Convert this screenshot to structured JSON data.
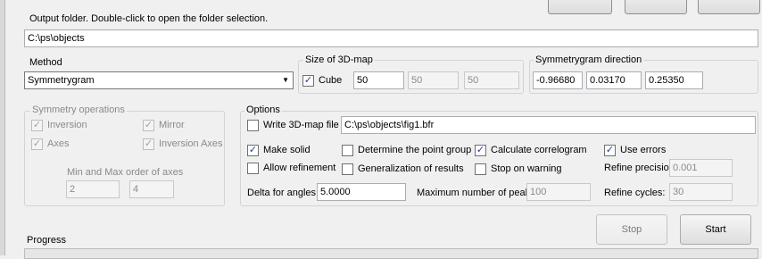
{
  "output_folder": {
    "hint": "Output folder. Double-click to open the folder selection.",
    "path": "C:\\ps\\objects"
  },
  "method": {
    "label": "Method",
    "selected": "Symmetrygram"
  },
  "map_size": {
    "label": "Size of 3D-map",
    "cube_label": "Cube",
    "cube_checked": true,
    "x": "50",
    "y": "50",
    "z": "50"
  },
  "direction": {
    "label": "Symmetrygram direction",
    "x": "-0.96680",
    "y": "0.03170",
    "z": "0.25350"
  },
  "symmetry_operations": {
    "label": "Symmetry operations",
    "inversion": "Inversion",
    "mirror": "Mirror",
    "axes": "Axes",
    "inversion_axes": "Inversion Axes",
    "order_label": "Min and Max order of axes",
    "min_order": "2",
    "max_order": "4"
  },
  "options": {
    "label": "Options",
    "write_map_label": "Write 3D-map file",
    "write_map_checked": false,
    "map_file": "C:\\ps\\objects\\fig1.bfr",
    "make_solid": "Make solid",
    "make_solid_checked": true,
    "determine_point_group": "Determine the point group",
    "determine_point_group_checked": false,
    "calc_correlogram": "Calculate correlogram",
    "calc_correlogram_checked": true,
    "use_errors": "Use errors",
    "use_errors_checked": true,
    "allow_refinement": "Allow refinement",
    "allow_refinement_checked": false,
    "generalization": "Generalization of results",
    "generalization_checked": false,
    "stop_on_warning": "Stop on warning",
    "stop_on_warning_checked": false,
    "refine_precision_label": "Refine precision:",
    "refine_precision": "0.001",
    "delta_label": "Delta for angles (deg):",
    "delta": "5.0000",
    "max_peaks_label": "Maximum number of peaks:",
    "max_peaks": "100",
    "refine_cycles_label": "Refine cycles:",
    "refine_cycles": "30"
  },
  "buttons": {
    "stop": "Stop",
    "start": "Start"
  },
  "progress": {
    "label": "Progress",
    "value": 0
  }
}
